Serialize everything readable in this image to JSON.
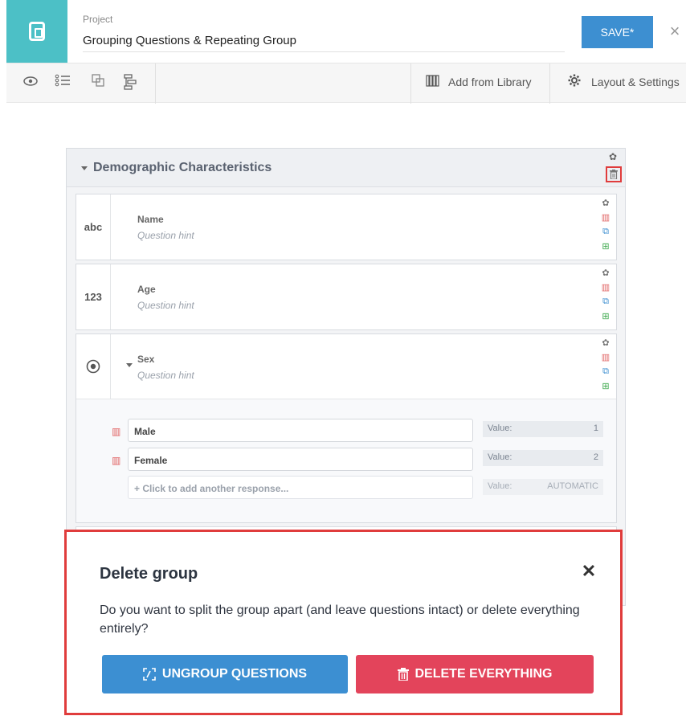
{
  "header": {
    "project_label": "Project",
    "project_title": "Grouping Questions & Repeating Group",
    "save_label": "SAVE*",
    "close_glyph": "×"
  },
  "toolbar": {
    "icons": [
      "eye-icon",
      "list-icon",
      "copy-group-icon",
      "tree-icon"
    ],
    "add_from_library": "Add from Library",
    "layout_settings": "Layout & Settings"
  },
  "group": {
    "title": "Demographic Characteristics"
  },
  "questions": [
    {
      "type_label": "abc",
      "name": "Name",
      "hint": "Question hint"
    },
    {
      "type_label": "123",
      "name": "Age",
      "hint": "Question hint"
    },
    {
      "type_label": "",
      "name": "Sex",
      "hint": "Question hint"
    }
  ],
  "responses": [
    {
      "label": "Male",
      "value_label": "Value:",
      "value": "1"
    },
    {
      "label": "Female",
      "value_label": "Value:",
      "value": "2"
    }
  ],
  "add_response": {
    "label": "+ Click to add another response...",
    "value_label": "Value:",
    "value": "AUTOMATIC"
  },
  "modal": {
    "title": "Delete group",
    "message": "Do you want to split the group apart (and leave questions intact) or delete everything entirely?",
    "ungroup_label": "UNGROUP QUESTIONS",
    "delete_label": "DELETE EVERYTHING",
    "close_glyph": "✕"
  },
  "colors": {
    "brand": "#4cc0c6",
    "primary": "#3c8fd2",
    "danger": "#e3445b",
    "highlight": "#e03c3c"
  }
}
